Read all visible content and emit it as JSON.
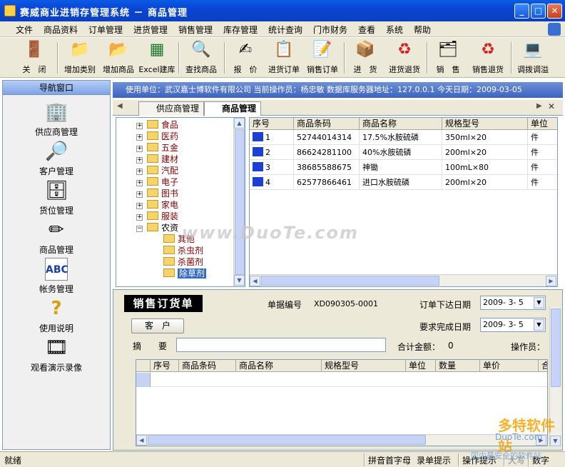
{
  "window": {
    "title": "赛威商业进销存管理系统 － 商品管理"
  },
  "menu": [
    "文件",
    "商品资料",
    "订单管理",
    "进货管理",
    "销售管理",
    "库存管理",
    "统计查询",
    "门市财务",
    "查看",
    "系统",
    "帮助"
  ],
  "toolbar": [
    {
      "label": "关　闭",
      "icon": "door-icon"
    },
    {
      "label": "增加类别",
      "icon": "folder-icon"
    },
    {
      "label": "增加商品",
      "icon": "folder-add-icon"
    },
    {
      "label": "Excel建库",
      "icon": "excel-icon"
    },
    {
      "label": "查找商品",
      "icon": "search-product-icon"
    },
    {
      "label": "报　价",
      "icon": "quote-icon"
    },
    {
      "label": "进货订单",
      "icon": "purchase-order-icon"
    },
    {
      "label": "销售订单",
      "icon": "sales-order-icon"
    },
    {
      "label": "进　货",
      "icon": "stock-in-icon"
    },
    {
      "label": "进货退货",
      "icon": "recycle-icon"
    },
    {
      "label": "销　售",
      "icon": "sell-icon"
    },
    {
      "label": "销售退货",
      "icon": "recycle-icon"
    },
    {
      "label": "调拨调溢",
      "icon": "transfer-icon"
    }
  ],
  "nav": {
    "title": "导航窗口",
    "items": [
      {
        "label": "供应商管理",
        "icon": "supplier-icon"
      },
      {
        "label": "客户管理",
        "icon": "customer-icon"
      },
      {
        "label": "货位管理",
        "icon": "location-icon"
      },
      {
        "label": "商品管理",
        "icon": "product-icon"
      },
      {
        "label": "帐务管理",
        "icon": "account-icon"
      },
      {
        "label": "使用说明",
        "icon": "help-icon"
      },
      {
        "label": "观看演示录像",
        "icon": "video-icon"
      }
    ]
  },
  "infobar": "使用单位：武汉嘉士博软件有限公司 当前操作员：杨忠敏 数据库服务器地址：127.0.0.1 今天日期：2009-03-05",
  "tabs": [
    {
      "label": "供应商管理",
      "active": false
    },
    {
      "label": "商品管理",
      "active": true
    }
  ],
  "tree": {
    "categories": [
      "食品",
      "医药",
      "五金",
      "建材",
      "汽配",
      "电子",
      "图书",
      "家电",
      "服装"
    ],
    "expanded": "农资",
    "children": [
      "其他",
      "杀虫剂",
      "杀菌剂",
      "除草剂"
    ],
    "selected": "除草剂"
  },
  "product_grid": {
    "columns": [
      "序号",
      "商品条码",
      "商品名称",
      "规格型号",
      "单位"
    ],
    "rows": [
      [
        "1",
        "52744014314",
        "17.5%水胺硫磷",
        "350ml×20",
        "件"
      ],
      [
        "2",
        "86624281100",
        "40%水胺硫磷",
        "200ml×20",
        "件"
      ],
      [
        "3",
        "38685588675",
        "神锄",
        "100mL×80",
        "件"
      ],
      [
        "4",
        "62577866461",
        "进口水胺硫磷",
        "200ml×20",
        "件"
      ]
    ]
  },
  "order": {
    "title": "销售订货单",
    "doc_no_label": "单据编号",
    "doc_no": "XD090305-0001",
    "order_date_label": "订单下达日期",
    "order_date": "2009- 3- 5",
    "due_date_label": "要求完成日期",
    "due_date": "2009- 3- 5",
    "customer_button": "客　户",
    "summary_label": "摘　　要",
    "summary_value": "",
    "total_label": "合计金额：",
    "total_value": "0",
    "operator_label": "操作员：",
    "columns": [
      "序号",
      "商品条码",
      "商品名称",
      "规格型号",
      "单位",
      "数量",
      "单价",
      "合"
    ]
  },
  "status": {
    "left": "就绪",
    "items": [
      "拼音首字母",
      "录单提示",
      "操作提示",
      "大写",
      "数字"
    ]
  },
  "watermark": {
    "text": "www.DuoTe.com",
    "corner": "多特软件站",
    "corner2": "DuoTe.com",
    "corner3": "国内最安全的软件站"
  }
}
